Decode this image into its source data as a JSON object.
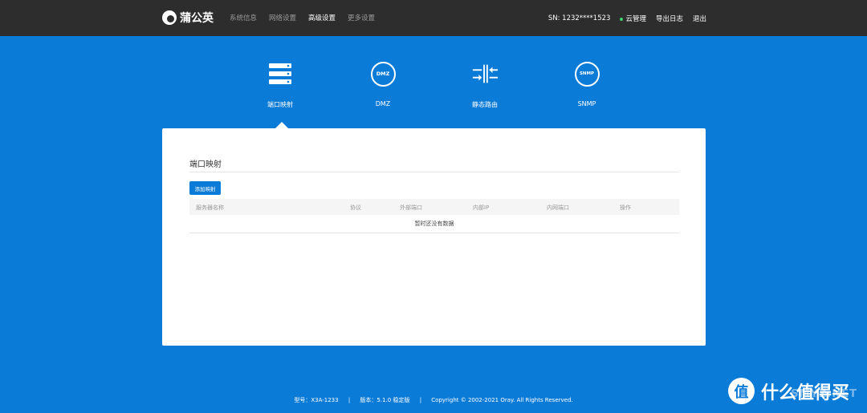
{
  "header": {
    "brand": "蒲公英",
    "nav": [
      {
        "label": "系统信息",
        "active": false
      },
      {
        "label": "网络设置",
        "active": false
      },
      {
        "label": "高级设置",
        "active": true
      },
      {
        "label": "更多设置",
        "active": false
      }
    ],
    "sn": "SN:  1232****1523",
    "cloud": "云管理",
    "export_log": "导出日志",
    "logout": "退出"
  },
  "features": [
    {
      "label": "端口映射",
      "icon": "server-stack-icon"
    },
    {
      "label": "DMZ",
      "icon": "dmz-icon",
      "icon_text": "DMZ"
    },
    {
      "label": "静态路由",
      "icon": "route-arrows-icon"
    },
    {
      "label": "SNMP",
      "icon": "snmp-icon",
      "icon_text": "SNMP"
    }
  ],
  "panel": {
    "title": "端口映射",
    "add_button": "添加映射",
    "columns": [
      "服务器名称",
      "协议",
      "外部端口",
      "内部IP",
      "内网端口",
      "操作"
    ],
    "empty_text": "暂时还没有数据"
  },
  "footer": {
    "model": "型号：X3A-1233",
    "sep1": "|",
    "version": "版本：5.1.0 稳定版",
    "sep2": "|",
    "copyright": "Copyright © 2002-2021 Oray. All Rights Reserved."
  },
  "watermark": {
    "glyph": "值",
    "text": "什么值得买",
    "sub": "SMYZ.NET"
  },
  "colors": {
    "accent": "#0b7bd8",
    "topbar": "#2d2d2d",
    "online": "#3bd36a"
  }
}
